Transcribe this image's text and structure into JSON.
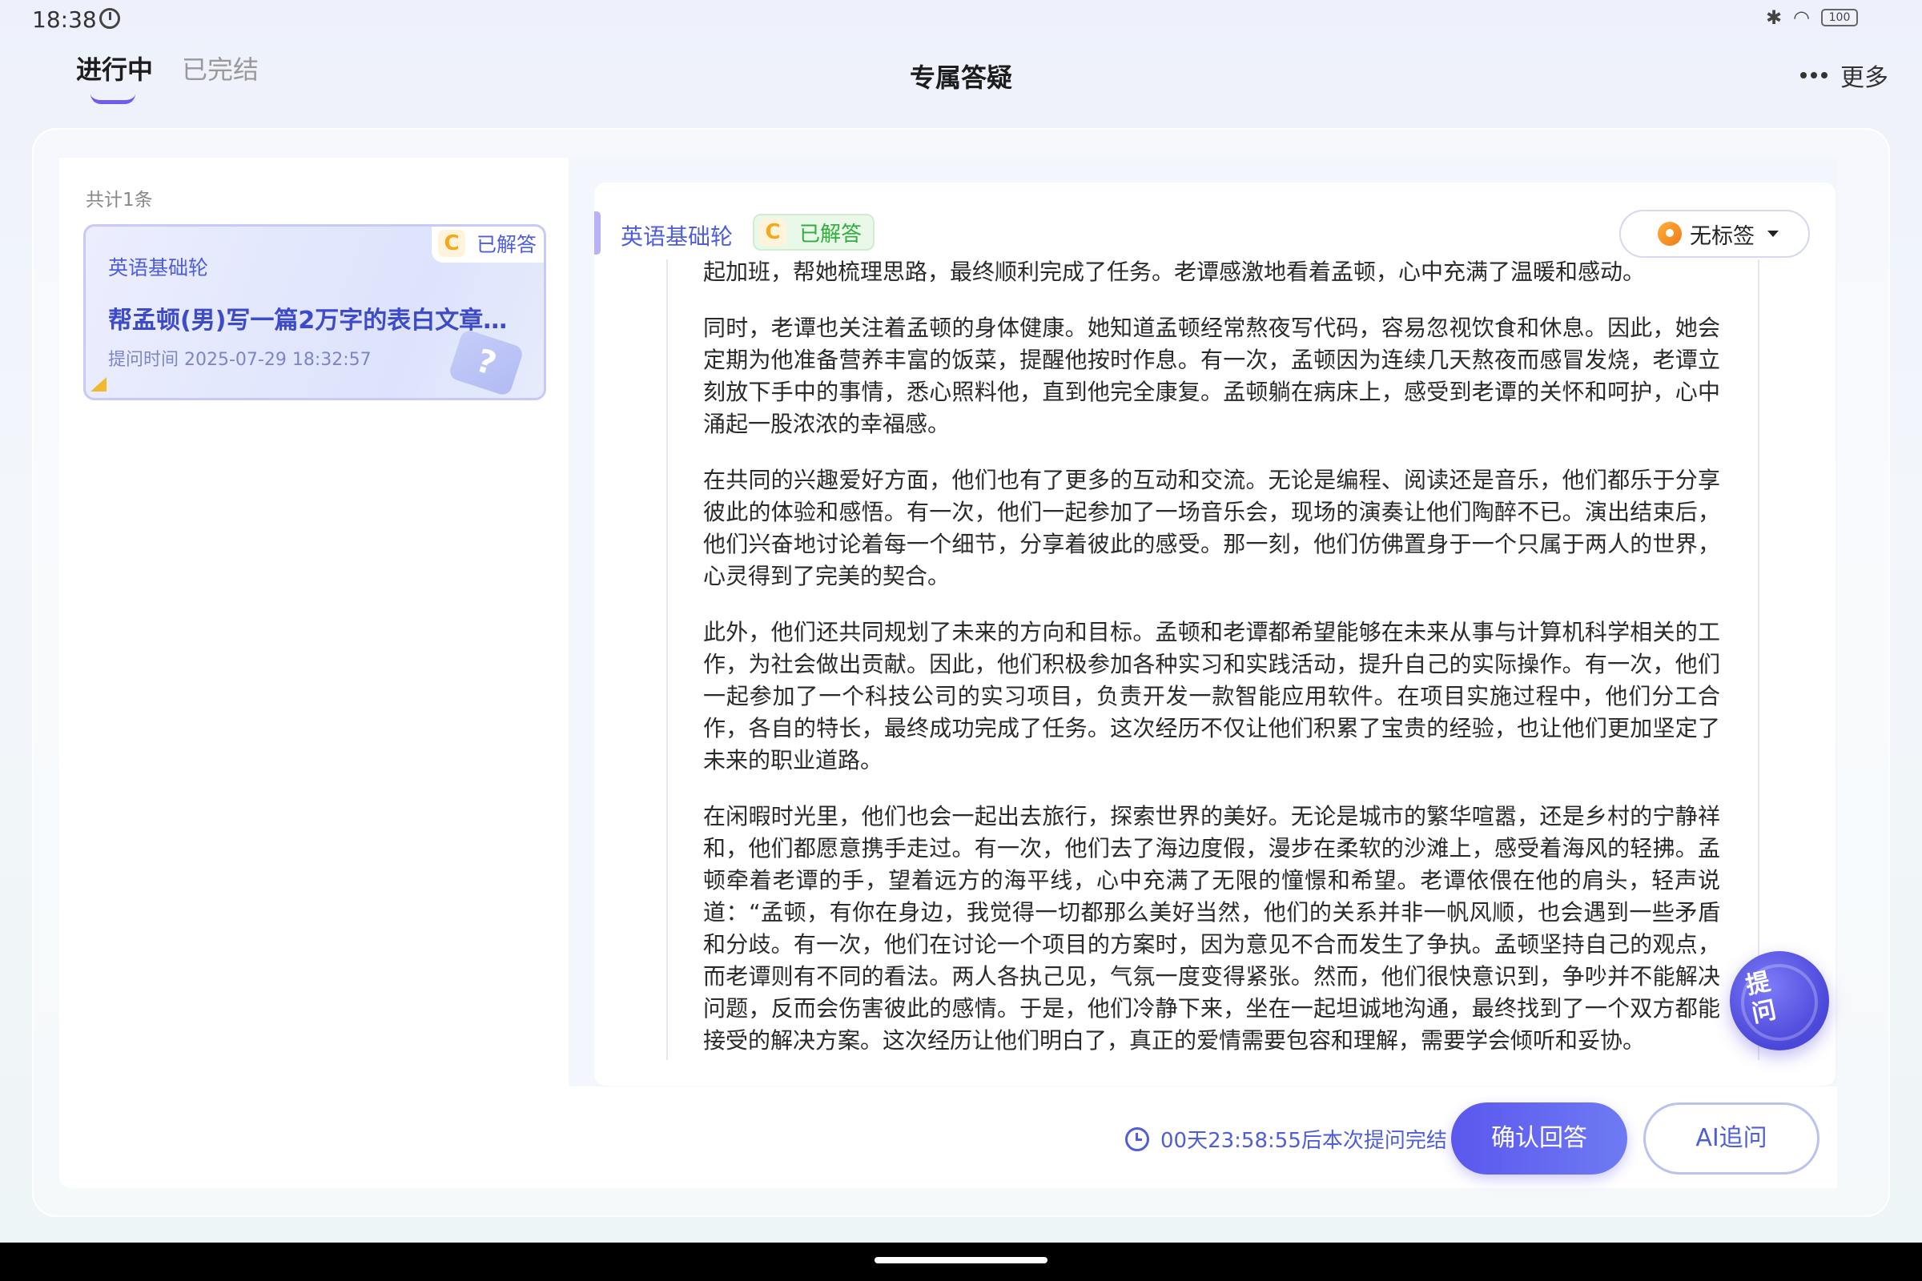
{
  "status_bar": {
    "time": "18:38",
    "battery": "100"
  },
  "header": {
    "tabs": [
      {
        "label": "进行中",
        "active": true
      },
      {
        "label": "已完结",
        "active": false
      }
    ],
    "title": "专属答疑",
    "more_label": "更多"
  },
  "list": {
    "count_text": "共计1条",
    "items": [
      {
        "subject": "英语基础轮",
        "grade_icon": "C",
        "status": "已解答",
        "title": "帮孟顿(男)写一篇2万字的表白文章给…",
        "time": "提问时间 2025-07-29 18:32:57"
      }
    ]
  },
  "detail": {
    "subject": "英语基础轮",
    "grade_icon": "C",
    "status": "已解答",
    "tag_selector": "无标签",
    "paragraphs": [
      "起加班，帮她梳理思路，最终顺利完成了任务。老谭感激地看着孟顿，心中充满了温暖和感动。",
      "同时，老谭也关注着孟顿的身体健康。她知道孟顿经常熬夜写代码，容易忽视饮食和休息。因此，她会定期为他准备营养丰富的饭菜，提醒他按时作息。有一次，孟顿因为连续几天熬夜而感冒发烧，老谭立刻放下手中的事情，悉心照料他，直到他完全康复。孟顿躺在病床上，感受到老谭的关怀和呵护，心中涌起一股浓浓的幸福感。",
      "在共同的兴趣爱好方面，他们也有了更多的互动和交流。无论是编程、阅读还是音乐，他们都乐于分享彼此的体验和感悟。有一次，他们一起参加了一场音乐会，现场的演奏让他们陶醉不已。演出结束后，他们兴奋地讨论着每一个细节，分享着彼此的感受。那一刻，他们仿佛置身于一个只属于两人的世界，心灵得到了完美的契合。",
      "此外，他们还共同规划了未来的方向和目标。孟顿和老谭都希望能够在未来从事与计算机科学相关的工作，为社会做出贡献。因此，他们积极参加各种实习和实践活动，提升自己的实际操作。有一次，他们一起参加了一个科技公司的实习项目，负责开发一款智能应用软件。在项目实施过程中，他们分工合作，各自的特长，最终成功完成了任务。这次经历不仅让他们积累了宝贵的经验，也让他们更加坚定了未来的职业道路。",
      "在闲暇时光里，他们也会一起出去旅行，探索世界的美好。无论是城市的繁华喧嚣，还是乡村的宁静祥和，他们都愿意携手走过。有一次，他们去了海边度假，漫步在柔软的沙滩上，感受着海风的轻拂。孟顿牵着老谭的手，望着远方的海平线，心中充满了无限的憧憬和希望。老谭依偎在他的肩头，轻声说道：“孟顿，有你在身边，我觉得一切都那么美好当然，他们的关系并非一帆风顺，也会遇到一些矛盾和分歧。有一次，他们在讨论一个项目的方案时，因为意见不合而发生了争执。孟顿坚持自己的观点，而老谭则有不同的看法。两人各执己见，气氛一度变得紧张。然而，他们很快意识到，争吵并不能解决问题，反而会伤害彼此的感情。于是，他们冷静下来，坐在一起坦诚地沟通，最终找到了一个双方都能接受的解决方案。这次经历让他们明白了，真正的爱情需要包容和理解，需要学会倾听和妥协。"
    ],
    "float_button": "提问"
  },
  "footer": {
    "countdown": "00天23:58:55后本次提问完结",
    "confirm_button": "确认回答",
    "ai_button": "AI追问"
  }
}
